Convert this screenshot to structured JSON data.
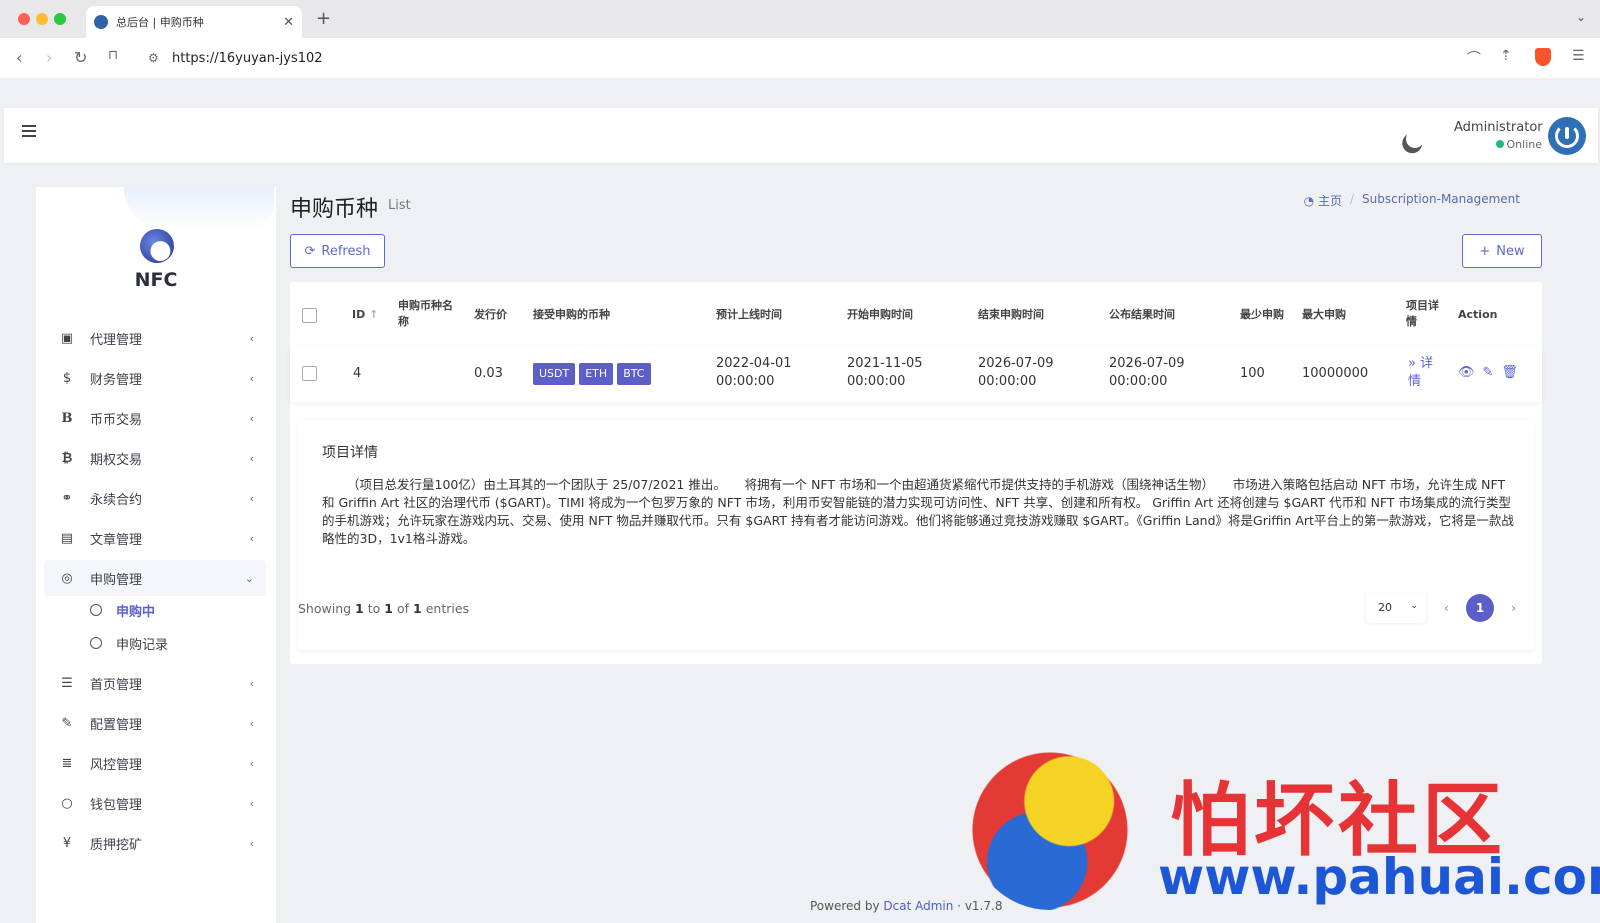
{
  "browser": {
    "tab_title": "总后台 | 申购币种",
    "url": "https://16yuyan-jys102",
    "traffic_colors": [
      "#ff5f57",
      "#febc2e",
      "#28c840"
    ]
  },
  "header": {
    "admin_name": "Administrator",
    "admin_status": "Online"
  },
  "sidebar": {
    "brand": "NFC",
    "items": [
      {
        "label": "代理管理",
        "icon": "id-card-icon"
      },
      {
        "label": "财务管理",
        "icon": "dollar-icon"
      },
      {
        "label": "币币交易",
        "icon": "b-icon"
      },
      {
        "label": "期权交易",
        "icon": "bitcoin-icon"
      },
      {
        "label": "永续合约",
        "icon": "link-icon"
      },
      {
        "label": "文章管理",
        "icon": "newspaper-icon"
      },
      {
        "label": "申购管理",
        "icon": "lifebuoy-icon"
      },
      {
        "label": "首页管理",
        "icon": "list-icon"
      },
      {
        "label": "配置管理",
        "icon": "wrench-icon"
      },
      {
        "label": "风控管理",
        "icon": "indent-icon"
      },
      {
        "label": "钱包管理",
        "icon": "circle-icon"
      },
      {
        "label": "质押挖矿",
        "icon": "yen-icon"
      }
    ],
    "sub_items": [
      {
        "label": "申购中"
      },
      {
        "label": "申购记录"
      }
    ]
  },
  "page": {
    "title": "申购币种",
    "subtitle": "List",
    "breadcrumb_home": "主页",
    "breadcrumb_current": "Subscription-Management",
    "refresh_label": "Refresh",
    "new_label": "New"
  },
  "table": {
    "headers": {
      "id": "ID",
      "name_1": "申购币种名",
      "name_2": "称",
      "price": "发行价",
      "accepted": "接受申购的币种",
      "launch": "预计上线时间",
      "start": "开始申购时间",
      "end": "结束申购时间",
      "publish": "公布结果时间",
      "min": "最少申购",
      "max": "最大申购",
      "detail_1": "项目详",
      "detail_2": "情",
      "action": "Action"
    },
    "row": {
      "id": "4",
      "price": "0.03",
      "coins": [
        "USDT",
        "ETH",
        "BTC"
      ],
      "launch_date": "2022-04-01",
      "launch_time": "00:00:00",
      "start_date": "2021-11-05",
      "start_time": "00:00:00",
      "end_date": "2026-07-09",
      "end_time": "00:00:00",
      "publish_date": "2026-07-09",
      "publish_time": "00:00:00",
      "min": "100",
      "max": "10000000",
      "detail_link_1": "详",
      "detail_link_2": "情"
    }
  },
  "detail": {
    "title": "项目详情",
    "text": "（项目总发行量100亿）由土耳其的一个团队于 25/07/2021 推出。　　将拥有一个 NFT 市场和一个由超通货紧缩代币提供支持的手机游戏（围绕神话生物）　　市场进入策略包括启动 NFT 市场，允许生成 NFT 和 Griffin Art 社区的治理代币 ($GART)。TIMI 将成为一个包罗万象的 NFT 市场，利用币安智能链的潜力实现可访问性、NFT 共享、创建和所有权。 Griffin Art 还将创建与 $GART 代币和 NFT 市场集成的流行类型的手机游戏；允许玩家在游戏内玩、交易、使用 NFT 物品并赚取代币。只有 $GART 持有者才能访问游戏。他们将能够通过竞技游戏赚取 $GART。《Griffin Land》将是Griffin Art平台上的第一款游戏，它将是一款战略性的3D，1v1格斗游戏。"
  },
  "pagination": {
    "showing_prefix": "Showing",
    "from": "1",
    "to_word": "to",
    "to": "1",
    "of_word": "of",
    "total": "1",
    "suffix": "entries",
    "per_page": "20",
    "current_page": "1"
  },
  "footer": {
    "powered": "Powered by",
    "link": "Dcat Admin",
    "version": "v1.7.8"
  },
  "watermark": {
    "cn": "怕坏社区",
    "url": "www.pahuai.com"
  }
}
